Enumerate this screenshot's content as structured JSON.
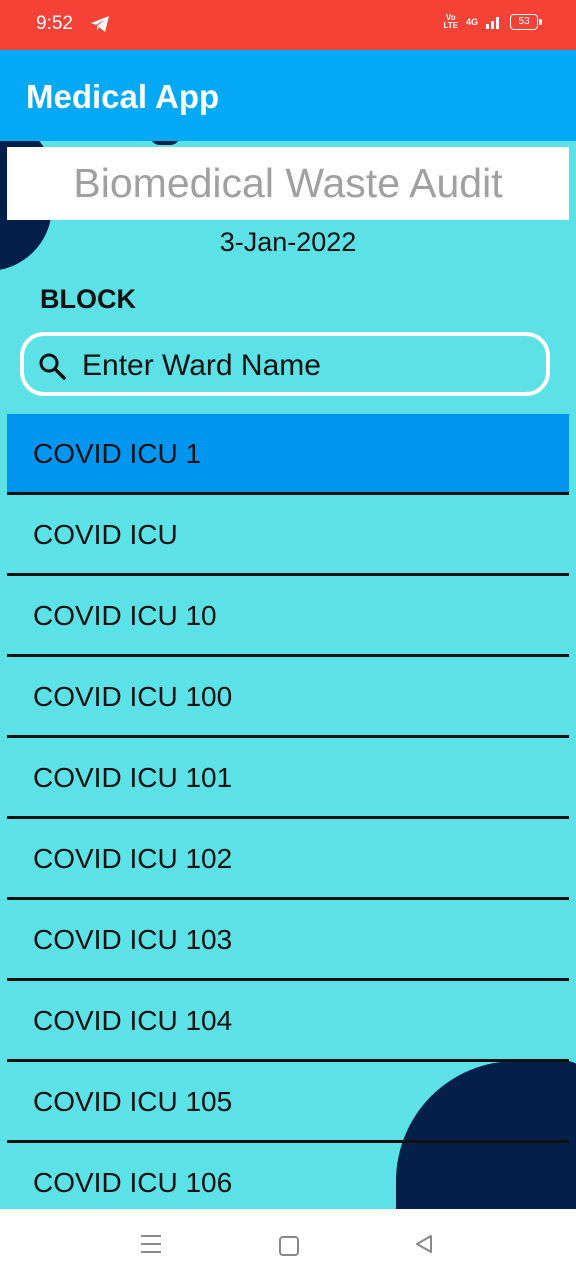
{
  "status_bar": {
    "time": "9:52",
    "volte_top": "Vo",
    "volte_bottom": "LTE",
    "network": "4G",
    "battery": "53"
  },
  "app_bar": {
    "title": "Medical App"
  },
  "header": {
    "title": "Biomedical Waste Audit",
    "date": "3-Jan-2022",
    "block_label": "BLOCK"
  },
  "search": {
    "placeholder": "Enter Ward Name",
    "value": ""
  },
  "wards": [
    "COVID ICU 1",
    "COVID ICU",
    "COVID ICU 10",
    "COVID ICU 100",
    "COVID ICU 101",
    "COVID ICU 102",
    "COVID ICU 103",
    "COVID ICU 104",
    "COVID ICU 105",
    "COVID ICU 106"
  ],
  "colors": {
    "status_bar": "#f44336",
    "app_bar": "#03a9f4",
    "background": "#5ce1e6",
    "selected_item": "#0096f0",
    "decoration": "#03204a"
  }
}
